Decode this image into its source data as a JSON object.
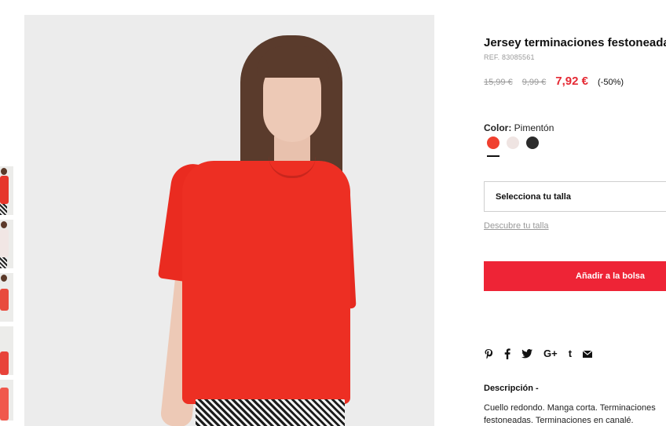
{
  "thumbnails": [
    "thumb-1",
    "thumb-2",
    "thumb-3",
    "thumb-4",
    "thumb-5"
  ],
  "product": {
    "title": "Jersey terminaciones festoneadas",
    "ref": "REF. 83085561",
    "original_price": "15,99 €",
    "previous_price": "9,99 €",
    "price": "7,92 €",
    "discount": "(-50%)",
    "color_label": "Color:",
    "color_value": "Pimentón",
    "swatches": [
      {
        "name": "Pimentón",
        "color": "#f0402f"
      },
      {
        "name": "light-pink",
        "color": "#efe4e2"
      },
      {
        "name": "black",
        "color": "#2b2b2b"
      }
    ],
    "size_select": "Selecciona tu talla",
    "size_guide": "Descubre tu talla",
    "add_to_bag": "Añadir a la bolsa",
    "social_icons": [
      "pinterest-icon",
      "facebook-icon",
      "twitter-icon",
      "google-plus-icon",
      "tumblr-icon",
      "email-icon"
    ],
    "description_title": "Descripción -",
    "description_text": "Cuello redondo. Manga corta. Terminaciones festoneadas. Terminaciones en canalé."
  },
  "colors": {
    "accent": "#ee2436",
    "price_red": "#e52a34"
  }
}
